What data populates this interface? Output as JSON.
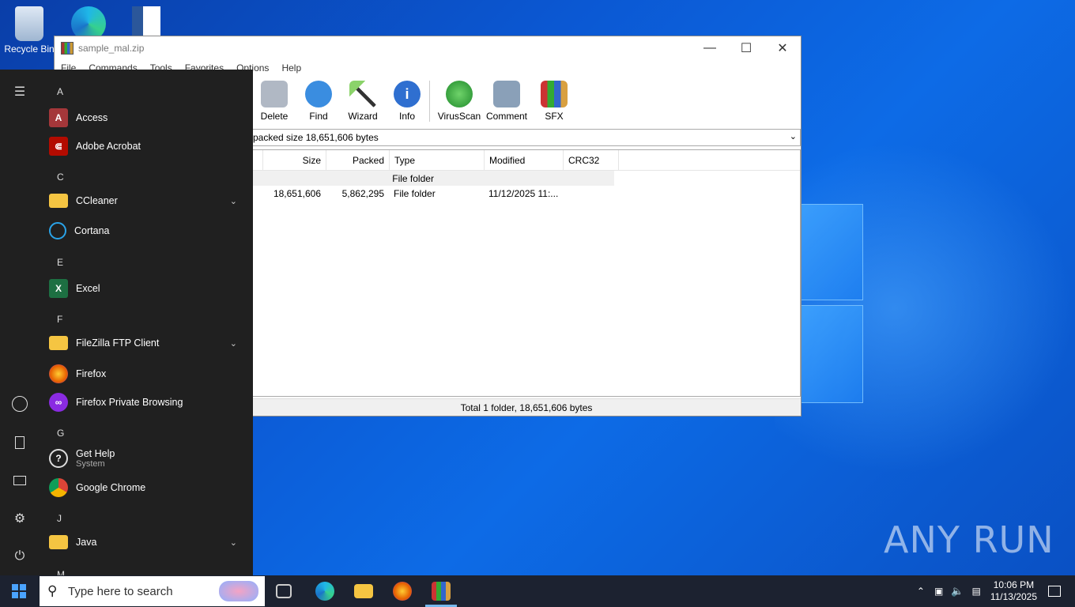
{
  "desktop": {
    "icons": [
      {
        "label": "Recycle Bin",
        "icon": "recycle-bin-icon"
      },
      {
        "label": "",
        "icon": "edge-icon"
      },
      {
        "label": "",
        "icon": "word-doc-icon"
      }
    ],
    "watermark": "ANY RUN"
  },
  "winrar": {
    "title": "sample_mal.zip",
    "menu": [
      "File",
      "Commands",
      "Tools",
      "Favorites",
      "Options",
      "Help"
    ],
    "toolbar": [
      {
        "label": "Delete",
        "icon": "trash-icon",
        "color": "#b0b8c4"
      },
      {
        "label": "Find",
        "icon": "magnifier-icon",
        "color": "#3a8de0"
      },
      {
        "label": "Wizard",
        "icon": "wand-icon",
        "color": "#8bd36a"
      },
      {
        "label": "Info",
        "icon": "info-icon",
        "color": "#2f6fd0"
      },
      {
        "label": "VirusScan",
        "icon": "virus-scan-icon",
        "color": "#2ea043"
      },
      {
        "label": "Comment",
        "icon": "comment-icon",
        "color": "#8aa0b8"
      },
      {
        "label": "SFX",
        "icon": "sfx-box-icon",
        "color": "#d9a040"
      }
    ],
    "address": "packed size 18,651,606 bytes",
    "columns": [
      "",
      "Size",
      "Packed",
      "Type",
      "Modified",
      "CRC32"
    ],
    "rows": [
      {
        "size": "",
        "packed": "",
        "type": "File folder",
        "modified": "",
        "crc": ""
      },
      {
        "size": "18,651,606",
        "packed": "5,862,295",
        "type": "File folder",
        "modified": "11/12/2025 11:...",
        "crc": ""
      }
    ],
    "status": "Total 1 folder, 18,651,606 bytes"
  },
  "start_menu": {
    "sections": [
      {
        "letter": "A",
        "apps": [
          {
            "name": "Access",
            "icon": "access-icon",
            "color": "#a4373a",
            "glyph": "A"
          },
          {
            "name": "Adobe Acrobat",
            "icon": "acrobat-icon",
            "color": "#b30b00",
            "glyph": "⋏"
          }
        ]
      },
      {
        "letter": "C",
        "apps": [
          {
            "name": "CCleaner",
            "icon": "folder-icon",
            "color": "#f5c542",
            "glyph": "",
            "expand": true
          },
          {
            "name": "Cortana",
            "icon": "cortana-icon",
            "color": "#202020",
            "glyph": "○"
          }
        ]
      },
      {
        "letter": "E",
        "apps": [
          {
            "name": "Excel",
            "icon": "excel-icon",
            "color": "#1d6f42",
            "glyph": "X"
          }
        ]
      },
      {
        "letter": "F",
        "apps": [
          {
            "name": "FileZilla FTP Client",
            "icon": "folder-icon",
            "color": "#f5c542",
            "glyph": "",
            "expand": true
          },
          {
            "name": "Firefox",
            "icon": "firefox-icon",
            "color": "#e66000",
            "glyph": "●"
          },
          {
            "name": "Firefox Private Browsing",
            "icon": "firefox-private-icon",
            "color": "#8a2be2",
            "glyph": "∞"
          }
        ]
      },
      {
        "letter": "G",
        "apps": [
          {
            "name": "Get Help",
            "sub": "System",
            "icon": "get-help-icon",
            "color": "#202020",
            "glyph": "?"
          },
          {
            "name": "Google Chrome",
            "icon": "chrome-icon",
            "color": "#4285f4",
            "glyph": "◉"
          }
        ]
      },
      {
        "letter": "J",
        "apps": [
          {
            "name": "Java",
            "icon": "folder-icon",
            "color": "#f5c542",
            "glyph": "",
            "expand": true
          }
        ]
      },
      {
        "letter": "M",
        "apps": []
      }
    ]
  },
  "taskbar": {
    "search_placeholder": "Type here to search",
    "time": "10:06 PM",
    "date": "11/13/2025"
  }
}
